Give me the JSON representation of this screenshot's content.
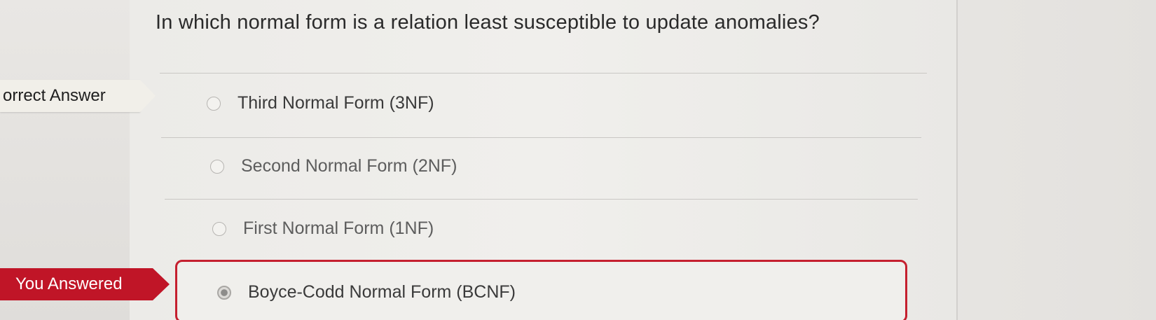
{
  "question": {
    "text": "In which normal form is a relation least susceptible to update anomalies?"
  },
  "tags": {
    "correct_answer": "orrect Answer",
    "you_answered": "You Answered"
  },
  "answers": [
    {
      "label": "Third Normal Form (3NF)",
      "selected": false
    },
    {
      "label": "Second Normal Form (2NF)",
      "selected": false
    },
    {
      "label": "First Normal Form (1NF)",
      "selected": false
    },
    {
      "label": "Boyce-Codd Normal Form (BCNF)",
      "selected": true
    }
  ],
  "colors": {
    "answered_tag": "#c01527",
    "answered_border": "#c5202f",
    "correct_tag": "#f1efe9"
  }
}
